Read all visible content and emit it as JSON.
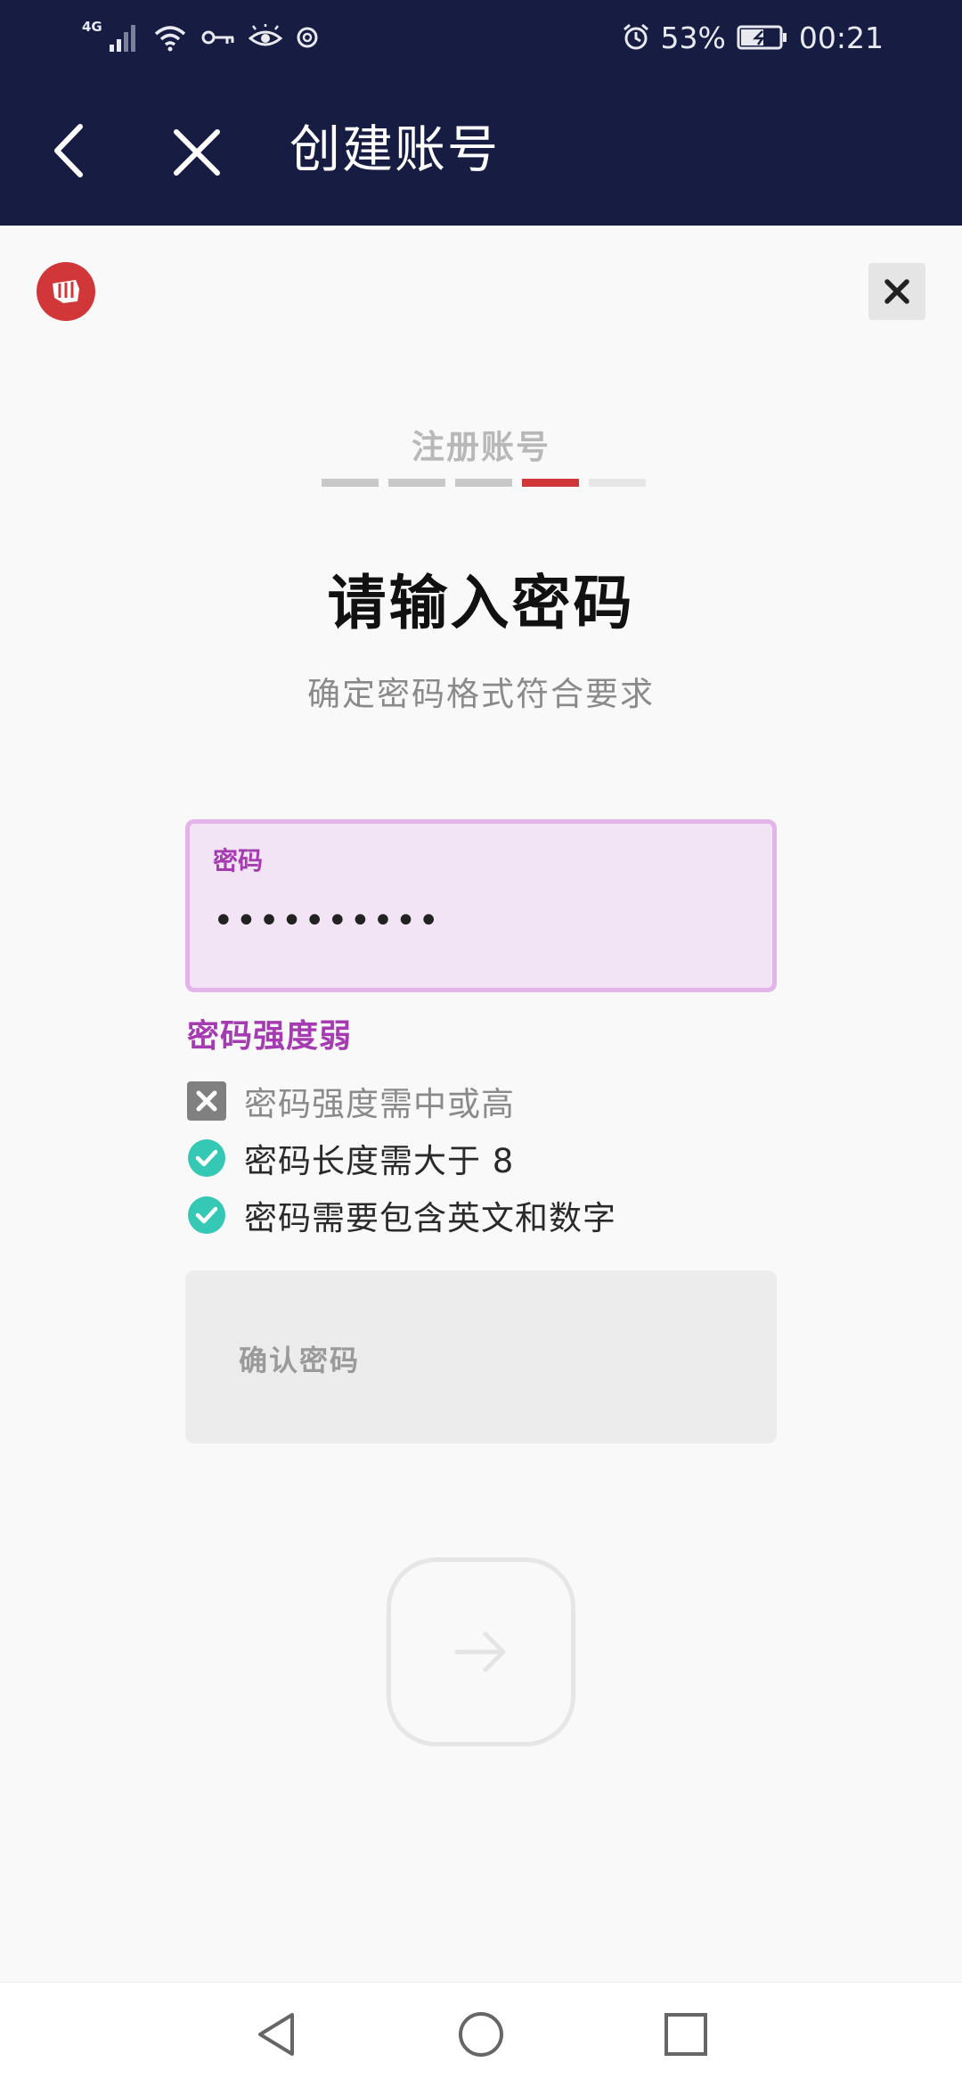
{
  "status_bar": {
    "network": "4G",
    "battery": "53%",
    "time": "00:21",
    "icons": [
      "signal-icon",
      "wifi-icon",
      "vpn-key-icon",
      "eye-comfort-icon",
      "sync-icon",
      "alarm-icon",
      "battery-charging-icon"
    ]
  },
  "app_bar": {
    "title": "创建账号",
    "back_icon": "chevron-left-icon",
    "close_icon": "close-icon"
  },
  "dialog": {
    "logo_icon": "riot-fist-icon",
    "close_icon": "close-icon"
  },
  "form": {
    "step_label": "注册账号",
    "progress": {
      "total_steps": 5,
      "current_step": 4
    },
    "heading": "请输入密码",
    "subtitle": "确定密码格式符合要求",
    "password_field": {
      "label": "密码",
      "value": "••••••••••"
    },
    "strength_text": "密码强度弱",
    "requirements": [
      {
        "text": "密码强度需中或高",
        "status": "fail"
      },
      {
        "text": "密码长度需大于 8",
        "status": "ok"
      },
      {
        "text": "密码需要包含英文和数字",
        "status": "ok"
      }
    ],
    "confirm_field": {
      "placeholder": "确认密码"
    },
    "next_button_icon": "arrow-right-icon"
  },
  "colors": {
    "header_bg": "#171c43",
    "accent_red": "#d13639",
    "accent_purple": "#a53bb0",
    "field_bg": "#f3e4f5",
    "check_teal": "#35c8b4"
  },
  "nav_bar": {
    "icons": [
      "nav-back-icon",
      "nav-home-icon",
      "nav-recents-icon"
    ]
  }
}
